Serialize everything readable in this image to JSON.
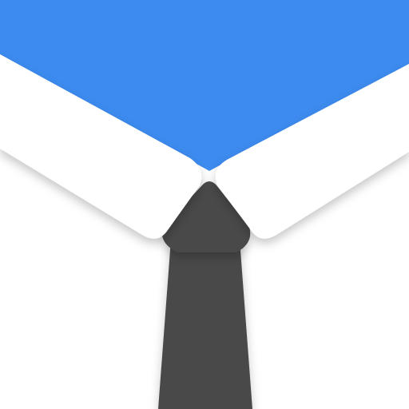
{
  "icon": {
    "name": "shirt-collar-tie-icon",
    "colors": {
      "background": "#ffffff",
      "collar_area": "#3d8bf0",
      "collar": "#ffffff",
      "tie": "#4a4a4a"
    }
  }
}
